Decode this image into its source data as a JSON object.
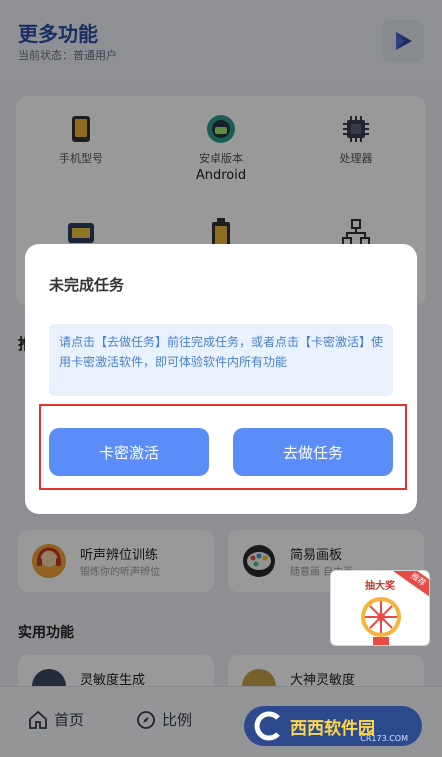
{
  "header": {
    "title": "更多功能",
    "status": "当前状态：普通用户",
    "play_icon": "play-triangle-icon"
  },
  "device_info": [
    {
      "label": "手机型号",
      "value": "",
      "icon": "phone-icon"
    },
    {
      "label": "安卓版本",
      "value": "Android",
      "icon": "android-icon"
    },
    {
      "label": "处理器",
      "value": "",
      "icon": "chip-icon"
    },
    {
      "label": "",
      "value": "",
      "icon": "vs-icon"
    },
    {
      "label": "",
      "value": "",
      "icon": "battery-icon"
    },
    {
      "label": "",
      "value": "",
      "icon": "network-icon"
    }
  ],
  "section_cut_label": "推",
  "tools": [
    {
      "title": "听声辨位训练",
      "subtitle": "锻炼你的听声辨位",
      "icon": "headset-avatar-icon"
    },
    {
      "title": "简易画板",
      "subtitle": "随意画 自由画",
      "icon": "palette-icon"
    }
  ],
  "utility_section": {
    "title": "实用功能",
    "items": [
      {
        "title": "灵敏度生成"
      },
      {
        "title": "大神灵敏度"
      }
    ]
  },
  "bottom_nav": [
    {
      "label": "首页",
      "icon": "home-icon"
    },
    {
      "label": "比例",
      "icon": "compass-icon"
    }
  ],
  "dialog": {
    "title": "未完成任务",
    "message": "请点击【去做任务】前往完成任务，或者点击【卡密激活】使用卡密激活软件，即可体验软件内所有功能",
    "btn_activate": "卡密激活",
    "btn_task": "去做任务"
  },
  "promo": {
    "title": "抽大奖",
    "tag": "推荐"
  },
  "watermark": {
    "main": "西西软件园",
    "sub": "CR173.COM"
  },
  "colors": {
    "accent": "#5b8cf7",
    "title_blue": "#2d4fa8",
    "highlight_red": "#e0352b"
  }
}
